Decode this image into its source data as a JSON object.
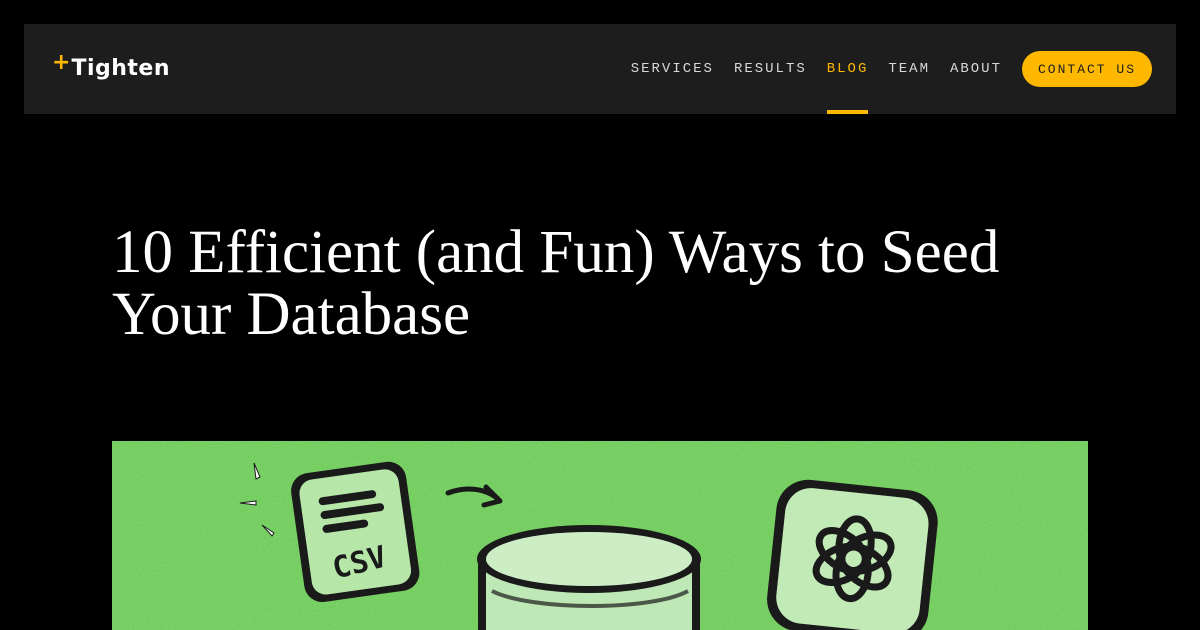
{
  "brand": {
    "plus": "+",
    "name": "Tighten"
  },
  "nav": {
    "items": [
      {
        "label": "SERVICES",
        "active": false
      },
      {
        "label": "RESULTS",
        "active": false
      },
      {
        "label": "BLOG",
        "active": true
      },
      {
        "label": "TEAM",
        "active": false
      },
      {
        "label": "ABOUT",
        "active": false
      }
    ],
    "contact_label": "CONTACT US"
  },
  "article": {
    "title": "10 Efficient (and Fun) Ways to Seed Your Database"
  },
  "hero": {
    "csv_label": "CSV",
    "background_color": "#6fcc5a",
    "icons": [
      "csv-file-icon",
      "arrow-icon",
      "database-icon",
      "openai-logo-icon"
    ]
  },
  "colors": {
    "accent": "#ffb800",
    "navbar_bg": "#1d1d1d",
    "page_bg": "#000000"
  }
}
